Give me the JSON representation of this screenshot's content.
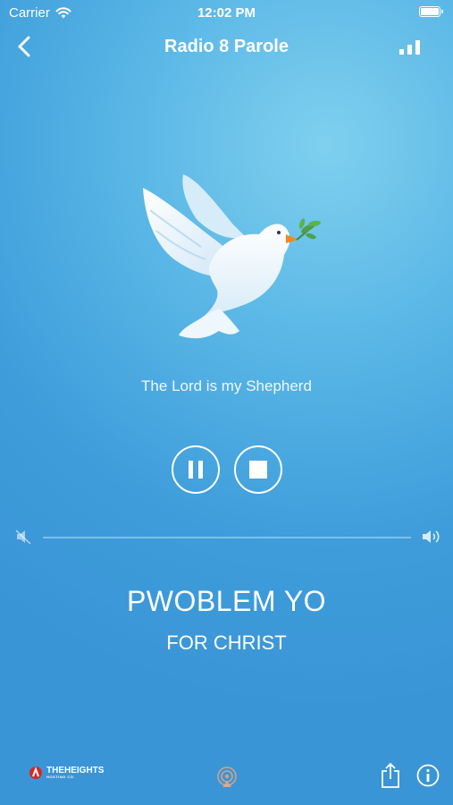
{
  "status_bar": {
    "carrier": "Carrier",
    "time": "12:02 PM",
    "battery_level": 1.0
  },
  "nav": {
    "title": "Radio 8 Parole",
    "back_icon": "chevron-left-icon",
    "signal_icon": "signal-bars-icon"
  },
  "artwork": {
    "icon": "dove-with-olive-branch"
  },
  "tagline": "The Lord is my Shepherd",
  "controls": {
    "pause_icon": "pause-icon",
    "stop_icon": "stop-icon"
  },
  "volume": {
    "level": 0.0,
    "mute_icon": "speaker-mute-icon",
    "max_icon": "speaker-loud-icon"
  },
  "now_playing": {
    "title": "PWOBLEM YO",
    "artist": "FOR CHRIST"
  },
  "footer": {
    "brand_name": "THEHEIGHTS",
    "brand_sub": "HOSTING CO.",
    "airplay_icon": "airplay-icon",
    "share_icon": "share-icon",
    "info_icon": "info-icon"
  },
  "colors": {
    "background_top": "#7fd0ee",
    "background_bottom": "#3a95d6",
    "foreground": "#ffffff"
  }
}
